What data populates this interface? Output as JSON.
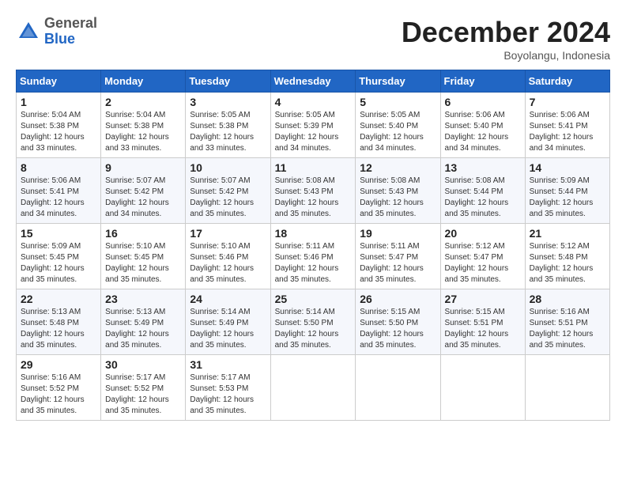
{
  "logo": {
    "general": "General",
    "blue": "Blue"
  },
  "header": {
    "month": "December 2024",
    "location": "Boyolangu, Indonesia"
  },
  "weekdays": [
    "Sunday",
    "Monday",
    "Tuesday",
    "Wednesday",
    "Thursday",
    "Friday",
    "Saturday"
  ],
  "weeks": [
    [
      {
        "day": "1",
        "sunrise": "5:04 AM",
        "sunset": "5:38 PM",
        "daylight": "12 hours and 33 minutes."
      },
      {
        "day": "2",
        "sunrise": "5:04 AM",
        "sunset": "5:38 PM",
        "daylight": "12 hours and 33 minutes."
      },
      {
        "day": "3",
        "sunrise": "5:05 AM",
        "sunset": "5:38 PM",
        "daylight": "12 hours and 33 minutes."
      },
      {
        "day": "4",
        "sunrise": "5:05 AM",
        "sunset": "5:39 PM",
        "daylight": "12 hours and 34 minutes."
      },
      {
        "day": "5",
        "sunrise": "5:05 AM",
        "sunset": "5:40 PM",
        "daylight": "12 hours and 34 minutes."
      },
      {
        "day": "6",
        "sunrise": "5:06 AM",
        "sunset": "5:40 PM",
        "daylight": "12 hours and 34 minutes."
      },
      {
        "day": "7",
        "sunrise": "5:06 AM",
        "sunset": "5:41 PM",
        "daylight": "12 hours and 34 minutes."
      }
    ],
    [
      {
        "day": "8",
        "sunrise": "5:06 AM",
        "sunset": "5:41 PM",
        "daylight": "12 hours and 34 minutes."
      },
      {
        "day": "9",
        "sunrise": "5:07 AM",
        "sunset": "5:42 PM",
        "daylight": "12 hours and 34 minutes."
      },
      {
        "day": "10",
        "sunrise": "5:07 AM",
        "sunset": "5:42 PM",
        "daylight": "12 hours and 35 minutes."
      },
      {
        "day": "11",
        "sunrise": "5:08 AM",
        "sunset": "5:43 PM",
        "daylight": "12 hours and 35 minutes."
      },
      {
        "day": "12",
        "sunrise": "5:08 AM",
        "sunset": "5:43 PM",
        "daylight": "12 hours and 35 minutes."
      },
      {
        "day": "13",
        "sunrise": "5:08 AM",
        "sunset": "5:44 PM",
        "daylight": "12 hours and 35 minutes."
      },
      {
        "day": "14",
        "sunrise": "5:09 AM",
        "sunset": "5:44 PM",
        "daylight": "12 hours and 35 minutes."
      }
    ],
    [
      {
        "day": "15",
        "sunrise": "5:09 AM",
        "sunset": "5:45 PM",
        "daylight": "12 hours and 35 minutes."
      },
      {
        "day": "16",
        "sunrise": "5:10 AM",
        "sunset": "5:45 PM",
        "daylight": "12 hours and 35 minutes."
      },
      {
        "day": "17",
        "sunrise": "5:10 AM",
        "sunset": "5:46 PM",
        "daylight": "12 hours and 35 minutes."
      },
      {
        "day": "18",
        "sunrise": "5:11 AM",
        "sunset": "5:46 PM",
        "daylight": "12 hours and 35 minutes."
      },
      {
        "day": "19",
        "sunrise": "5:11 AM",
        "sunset": "5:47 PM",
        "daylight": "12 hours and 35 minutes."
      },
      {
        "day": "20",
        "sunrise": "5:12 AM",
        "sunset": "5:47 PM",
        "daylight": "12 hours and 35 minutes."
      },
      {
        "day": "21",
        "sunrise": "5:12 AM",
        "sunset": "5:48 PM",
        "daylight": "12 hours and 35 minutes."
      }
    ],
    [
      {
        "day": "22",
        "sunrise": "5:13 AM",
        "sunset": "5:48 PM",
        "daylight": "12 hours and 35 minutes."
      },
      {
        "day": "23",
        "sunrise": "5:13 AM",
        "sunset": "5:49 PM",
        "daylight": "12 hours and 35 minutes."
      },
      {
        "day": "24",
        "sunrise": "5:14 AM",
        "sunset": "5:49 PM",
        "daylight": "12 hours and 35 minutes."
      },
      {
        "day": "25",
        "sunrise": "5:14 AM",
        "sunset": "5:50 PM",
        "daylight": "12 hours and 35 minutes."
      },
      {
        "day": "26",
        "sunrise": "5:15 AM",
        "sunset": "5:50 PM",
        "daylight": "12 hours and 35 minutes."
      },
      {
        "day": "27",
        "sunrise": "5:15 AM",
        "sunset": "5:51 PM",
        "daylight": "12 hours and 35 minutes."
      },
      {
        "day": "28",
        "sunrise": "5:16 AM",
        "sunset": "5:51 PM",
        "daylight": "12 hours and 35 minutes."
      }
    ],
    [
      {
        "day": "29",
        "sunrise": "5:16 AM",
        "sunset": "5:52 PM",
        "daylight": "12 hours and 35 minutes."
      },
      {
        "day": "30",
        "sunrise": "5:17 AM",
        "sunset": "5:52 PM",
        "daylight": "12 hours and 35 minutes."
      },
      {
        "day": "31",
        "sunrise": "5:17 AM",
        "sunset": "5:53 PM",
        "daylight": "12 hours and 35 minutes."
      },
      null,
      null,
      null,
      null
    ]
  ],
  "labels": {
    "sunrise": "Sunrise:",
    "sunset": "Sunset:",
    "daylight": "Daylight:"
  }
}
